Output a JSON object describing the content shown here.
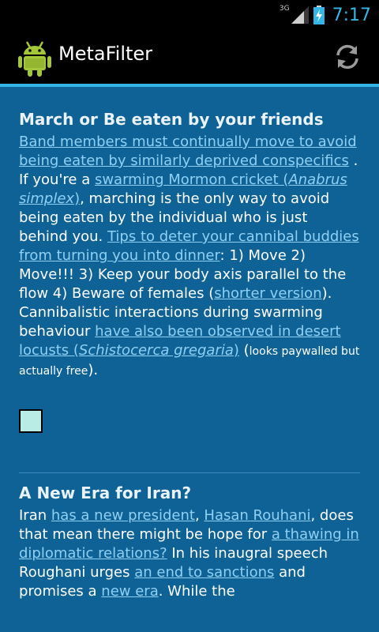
{
  "status": {
    "network": "3G",
    "time": "7:17"
  },
  "app": {
    "title": "MetaFilter"
  },
  "post1": {
    "title": "March or Be eaten by your friends",
    "link1": "Band members must continually move to avoid being eaten by similarly deprived conspecifics",
    "t1": " . If you're a ",
    "link2": "swarming Mormon cricket (",
    "link2_italic": "Anabrus simplex",
    "link2_end": ")",
    "t2": ", marching is the only way to avoid being eaten by the individual who is just behind you. ",
    "link3": "Tips to deter your cannibal buddies from turning you into dinner",
    "t3": ": 1) Move 2) Move!!! 3) Keep your body axis parallel to the flow 4) Beware of females (",
    "link4": "shorter version",
    "t4": "). Cannibalistic interactions during swarming behaviour ",
    "link5": "have also been observed in desert locusts (",
    "link5_italic": "Schistocerca gregaria",
    "link5_end": ")",
    "t5_open": " (",
    "t5_small": "looks paywalled but actually free",
    "t5_close": ")."
  },
  "post2": {
    "title": "A New Era for Iran?",
    "t1": "Iran ",
    "link1": "has a new president",
    "t2": ", ",
    "link2": "Hasan Rouhani",
    "t3": ", does that mean there might be hope for ",
    "link3": "a thawing in diplomatic relations?",
    "t4": " In his inaugral speech Roughani urges ",
    "link4": "an end to sanctions",
    "t5": " and promises a ",
    "link5": "new era",
    "t6": ". While the"
  },
  "colors": {
    "background": "#0f6295",
    "accent": "#33b5e5",
    "link": "#8fd0f4"
  }
}
